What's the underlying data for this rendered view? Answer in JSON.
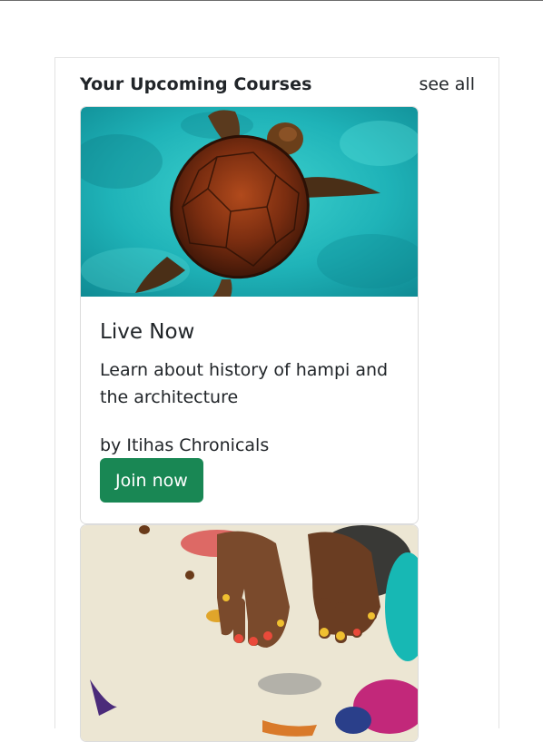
{
  "section": {
    "title": "Your Upcoming Courses",
    "see_all_label": "see all"
  },
  "courses": [
    {
      "status": "Live Now",
      "description": "Learn about history of hampi and the architecture",
      "author": "by Itihas Chronicals",
      "join_label": "Join now",
      "image": "sea-turtle-photo"
    },
    {
      "image": "painted-hands-photo"
    }
  ],
  "colors": {
    "join_button": "#198754",
    "text": "#212529",
    "border": "#dcdcdc"
  }
}
